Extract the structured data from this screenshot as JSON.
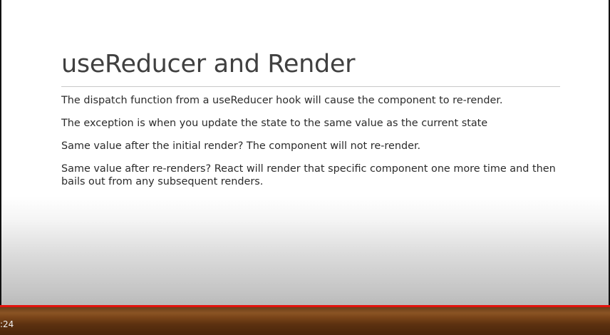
{
  "slide": {
    "title": "useReducer and Render",
    "bullets": [
      "The dispatch function from a useReducer hook will cause the component to re-render.",
      "The exception is when you update the state to the same value as the current state",
      "Same value after the initial render? The component will not re-render.",
      "Same value after re-renders? React will render that specific component one more time and then bails out from any subsequent renders."
    ]
  },
  "player": {
    "time_display": ":24",
    "progress_color": "#e3130e",
    "control_bar_color": "#6b3e19"
  }
}
